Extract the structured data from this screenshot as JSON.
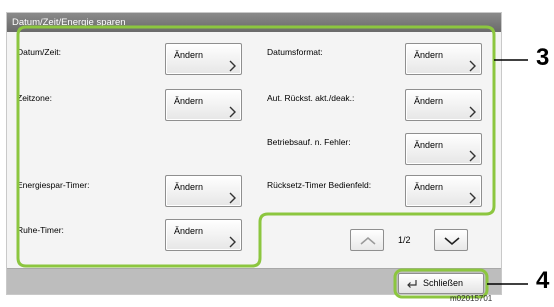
{
  "window": {
    "title": "Datum/Zeit/Energie sparen"
  },
  "settings": {
    "left": [
      {
        "label": "Datum/Zeit:",
        "button": "Ändern"
      },
      {
        "label": "Zeitzone:",
        "button": "Ändern"
      },
      {
        "label": "Energiespar-Timer:",
        "button": "Ändern"
      },
      {
        "label": "Ruhe-Timer:",
        "button": "Ändern"
      }
    ],
    "right": [
      {
        "label": "Datumsformat:",
        "button": "Ändern"
      },
      {
        "label": "Aut. Rückst. akt./deak.:",
        "button": "Ändern"
      },
      {
        "label": "Betriebsauf. n. Fehler:",
        "button": "Ändern"
      },
      {
        "label": "Rücksetz-Timer Bedienfeld:",
        "button": "Ändern"
      }
    ]
  },
  "pagination": {
    "indicator": "1/2"
  },
  "footer": {
    "close_label": "Schließen"
  },
  "callouts": {
    "area": "3",
    "close": "4"
  },
  "image_code": "m02015701"
}
